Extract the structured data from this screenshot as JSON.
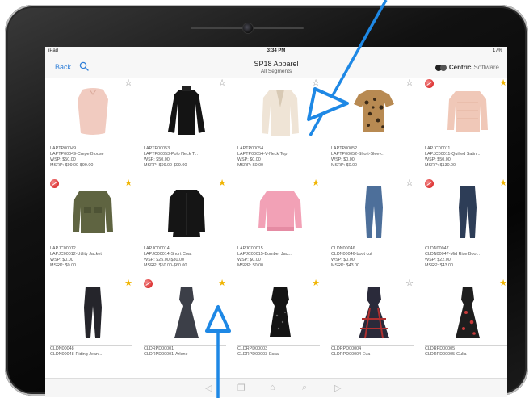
{
  "status": {
    "carrier": "iPad",
    "time": "3:34 PM",
    "battery": "17%"
  },
  "nav": {
    "back_label": "Back",
    "title": "SP18 Apparel",
    "subtitle": "All Segments"
  },
  "brand": {
    "bold": "Centric",
    "light": "Software"
  },
  "products": [
    {
      "code": "LAPTP00049",
      "name": "LAPTP00049-Crepe Blouse",
      "wsp": "WSP: $50.00",
      "msrp": "MSRP: $99.00-$99.00",
      "starred": false,
      "flag": false,
      "garment": "blouse-pink"
    },
    {
      "code": "LAPTP00053",
      "name": "LAPTP00053-Polo Neck T...",
      "wsp": "WSP: $50.00",
      "msrp": "MSRP: $99.00-$99.00",
      "starred": false,
      "flag": false,
      "garment": "black-top"
    },
    {
      "code": "LAPTP00054",
      "name": "LAPTP00054-V-Neck Top",
      "wsp": "WSP: $0.00",
      "msrp": "MSRP: $0.00",
      "starred": false,
      "flag": false,
      "garment": "cream-cardigan"
    },
    {
      "code": "LAPTP00052",
      "name": "LAPTP00052-Short-Sleev...",
      "wsp": "WSP: $0.00",
      "msrp": "MSRP: $0.00",
      "starred": false,
      "flag": false,
      "garment": "leopard-tee"
    },
    {
      "code": "LAPJC00011",
      "name": "LAPJC00011-Quilted Satin...",
      "wsp": "WSP: $50.00",
      "msrp": "MSRP: $130.00",
      "starred": true,
      "flag": true,
      "garment": "pink-bomber"
    },
    {
      "code": "LAPJC00012",
      "name": "LAPJC00012-Utility Jacket",
      "wsp": "WSP: $0.00",
      "msrp": "MSRP: $0.00",
      "starred": true,
      "flag": true,
      "garment": "olive-jacket"
    },
    {
      "code": "LAPJC00014",
      "name": "LAPJC00014-Short Coat",
      "wsp": "WSP: $25.00-$30.00",
      "msrp": "MSRP: $50.00-$60.00",
      "starred": true,
      "flag": false,
      "garment": "black-coat"
    },
    {
      "code": "LAPJC00015",
      "name": "LAPJC00015-Bomber Jac...",
      "wsp": "WSP: $0.00",
      "msrp": "MSRP: $0.00",
      "starred": true,
      "flag": false,
      "garment": "pink-jacket"
    },
    {
      "code": "CLDN00046",
      "name": "CLDN00046-boot cut",
      "wsp": "WSP: $0.00",
      "msrp": "MSRP: $43.00",
      "starred": false,
      "flag": false,
      "garment": "jeans-blue"
    },
    {
      "code": "CLDN00047",
      "name": "CLDN00047-Mid Rise Boo...",
      "wsp": "WSP: $22.00",
      "msrp": "MSRP: $43.00",
      "starred": true,
      "flag": true,
      "garment": "jeans-dark"
    },
    {
      "code": "CLDN00048",
      "name": "CLDN00048-Riding Jean...",
      "wsp": "",
      "msrp": "",
      "starred": true,
      "flag": false,
      "garment": "jeans-black"
    },
    {
      "code": "CLDRPD00001",
      "name": "CLDRPD00001-Arlene",
      "wsp": "",
      "msrp": "",
      "starred": true,
      "flag": true,
      "garment": "gown-grey"
    },
    {
      "code": "CLDRPD00003",
      "name": "CLDRPD00003-Essa",
      "wsp": "",
      "msrp": "",
      "starred": true,
      "flag": false,
      "garment": "dress-black"
    },
    {
      "code": "CLDRPD00004",
      "name": "CLDRPD00004-Eva",
      "wsp": "",
      "msrp": "",
      "starred": false,
      "flag": false,
      "garment": "gown-plaid"
    },
    {
      "code": "CLDRPD00005",
      "name": "CLDRPD00005-Gulia",
      "wsp": "",
      "msrp": "",
      "starred": true,
      "flag": false,
      "garment": "gown-floral"
    }
  ],
  "colors": {
    "accent": "#2f7fd8",
    "star_on": "#f0b400",
    "annotation_arrow": "#1e88e5"
  }
}
